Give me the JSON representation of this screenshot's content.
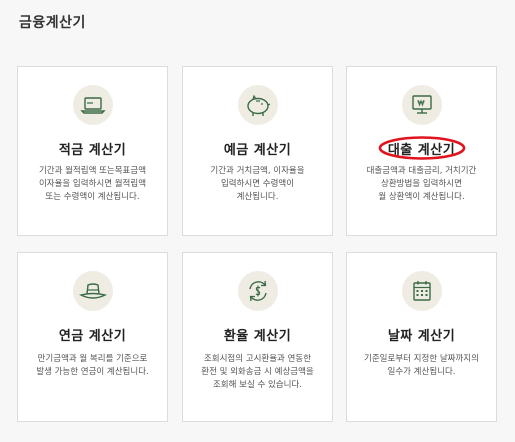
{
  "page": {
    "title": "금융계산기"
  },
  "cards": [
    {
      "title": "적금 계산기",
      "icon": "laptop-icon",
      "description": "기간과 월적립액 또는목표금액\n이자율을 입력하시면 월적립액\n또는 수령액이 계산됩니다."
    },
    {
      "title": "예금 계산기",
      "icon": "piggy-bank-icon",
      "description": "기간과 거치금액, 이자율을\n입력하시면 수령액이\n계산됩니다."
    },
    {
      "title": "대출 계산기",
      "icon": "monitor-won-icon",
      "description": "대출금액과 대출금리, 거치기간\n상환방법을 입력하시면\n월 상환액이 계산됩니다."
    },
    {
      "title": "연금 계산기",
      "icon": "hat-icon",
      "description": "만기금액과 월 복리를 기준으로\n발생 가능한 연금이 계산됩니다."
    },
    {
      "title": "환율 계산기",
      "icon": "currency-exchange-icon",
      "description": "조회시점의 고시환율과 연동한\n환전 및 외화송금 시 예상금액을\n조회해 보실 수 있습니다."
    },
    {
      "title": "날짜 계산기",
      "icon": "calendar-icon",
      "description": "기준일로부터 지정한 날짜까지의\n일수가 계산됩니다."
    }
  ],
  "colors": {
    "icon_green": "#3a6b45",
    "icon_bg": "#efece4",
    "annotation_red": "#e0141e"
  }
}
